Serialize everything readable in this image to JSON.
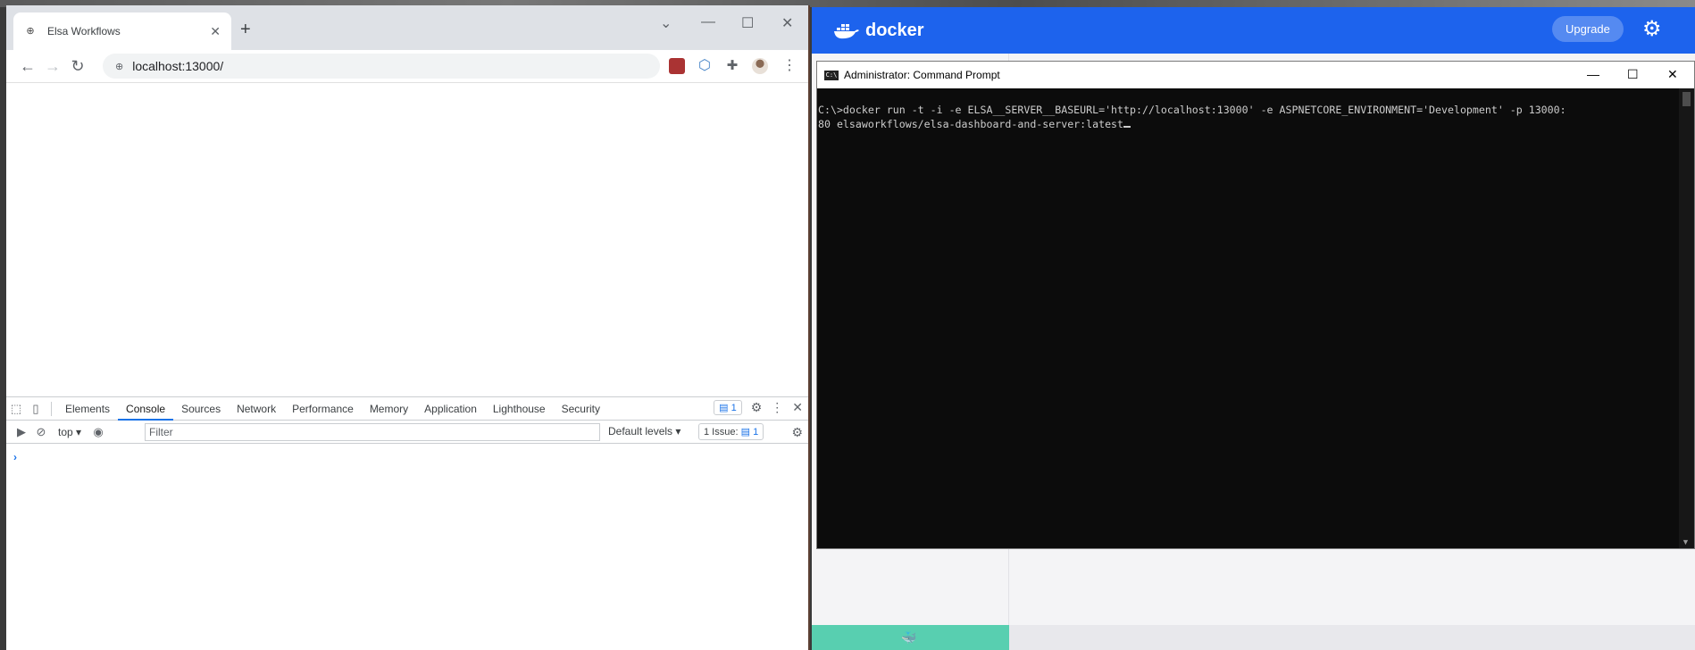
{
  "chrome": {
    "tab_title": "Elsa Workflows",
    "tab_close": "✕",
    "new_tab": "+",
    "url": "localhost:13000/",
    "devtools": {
      "tabs": [
        "Elements",
        "Console",
        "Sources",
        "Network",
        "Performance",
        "Memory",
        "Application",
        "Lighthouse",
        "Security"
      ],
      "active_tab": "Console",
      "messages_badge": "1",
      "context": "top",
      "filter_placeholder": "Filter",
      "levels": "Default levels",
      "issues_label": "1 Issue:",
      "issues_count": "1",
      "prompt": "›"
    }
  },
  "docker": {
    "logo_text": "docker",
    "upgrade_label": "Upgrade",
    "accent": "#1d63ed",
    "status_color": "#58cfb0"
  },
  "cmd": {
    "title": "Administrator: Command Prompt",
    "icon_text": "C:\\",
    "line1": "C:\\>docker run -t -i -e ELSA__SERVER__BASEURL='http://localhost:13000' -e ASPNETCORE_ENVIRONMENT='Development' -p 13000:",
    "line2": "80 elsaworkflows/elsa-dashboard-and-server:latest"
  }
}
